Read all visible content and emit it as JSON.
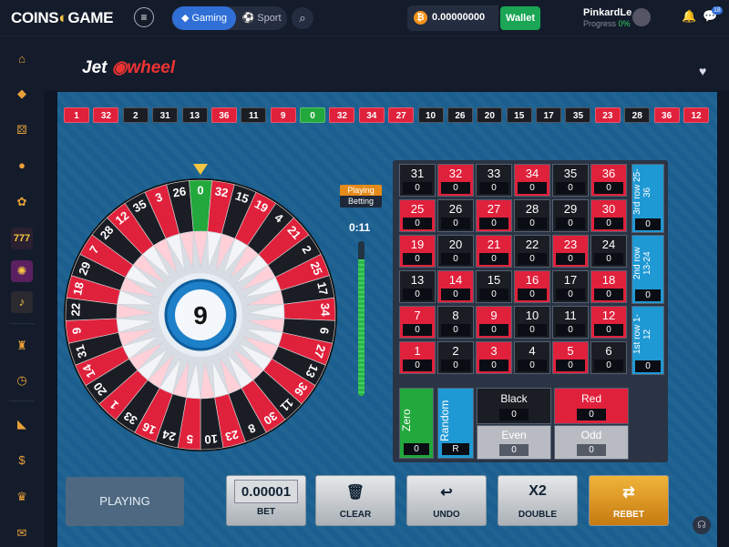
{
  "topbar": {
    "logo_part1": "COINS",
    "logo_part2": "GAME",
    "menu_icon": "≡",
    "mode_gaming": "Gaming",
    "mode_sport": "Sport",
    "balance": "0.00000000",
    "currency_icon": "₿",
    "wallet_label": "Wallet",
    "username": "PinkardLe",
    "progress_label": "Progress",
    "progress_value": "0%",
    "chat_badge": "18"
  },
  "sidebar": {
    "icons": [
      "home-icon",
      "cube-icon",
      "dice-icon",
      "ball-icon",
      "candy-icon",
      "slots-777-icon",
      "wheel-icon",
      "bell-icon",
      "castle-icon",
      "clock-icon",
      "cheese-icon",
      "money-bag-icon",
      "crown-icon",
      "gift-icon"
    ]
  },
  "game": {
    "logo_jet": "Jet",
    "logo_wheel": "wheel",
    "result_number": "9",
    "status_top": "Playing",
    "status_bottom": "Betting",
    "timer": "0:11",
    "timer_progress": 0.88
  },
  "history": [
    {
      "n": "1",
      "c": "red"
    },
    {
      "n": "32",
      "c": "red"
    },
    {
      "n": "2",
      "c": "black"
    },
    {
      "n": "31",
      "c": "black"
    },
    {
      "n": "13",
      "c": "black"
    },
    {
      "n": "36",
      "c": "red"
    },
    {
      "n": "11",
      "c": "black"
    },
    {
      "n": "9",
      "c": "red"
    },
    {
      "n": "0",
      "c": "green"
    },
    {
      "n": "32",
      "c": "red"
    },
    {
      "n": "34",
      "c": "red"
    },
    {
      "n": "27",
      "c": "red"
    },
    {
      "n": "10",
      "c": "black"
    },
    {
      "n": "26",
      "c": "black"
    },
    {
      "n": "20",
      "c": "black"
    },
    {
      "n": "15",
      "c": "black"
    },
    {
      "n": "17",
      "c": "black"
    },
    {
      "n": "35",
      "c": "black"
    },
    {
      "n": "23",
      "c": "red"
    },
    {
      "n": "28",
      "c": "black"
    },
    {
      "n": "36",
      "c": "red"
    },
    {
      "n": "12",
      "c": "red"
    }
  ],
  "wheel": {
    "sequence": [
      "0",
      "32",
      "15",
      "19",
      "4",
      "21",
      "2",
      "25",
      "17",
      "34",
      "6",
      "27",
      "13",
      "36",
      "11",
      "30",
      "8",
      "23",
      "10",
      "5",
      "24",
      "16",
      "33",
      "1",
      "20",
      "14",
      "31",
      "9",
      "22",
      "18",
      "29",
      "7",
      "28",
      "12",
      "35",
      "3",
      "26"
    ],
    "red_numbers": [
      "1",
      "3",
      "5",
      "7",
      "9",
      "12",
      "14",
      "16",
      "18",
      "19",
      "21",
      "23",
      "25",
      "27",
      "30",
      "32",
      "34",
      "36"
    ]
  },
  "board": {
    "grid": [
      [
        "31",
        "32",
        "33",
        "34",
        "35",
        "36"
      ],
      [
        "25",
        "26",
        "27",
        "28",
        "29",
        "30"
      ],
      [
        "19",
        "20",
        "21",
        "22",
        "23",
        "24"
      ],
      [
        "13",
        "14",
        "15",
        "16",
        "17",
        "18"
      ],
      [
        "7",
        "8",
        "9",
        "10",
        "11",
        "12"
      ],
      [
        "1",
        "2",
        "3",
        "4",
        "5",
        "6"
      ]
    ],
    "bet_value": "0",
    "rows": [
      {
        "label": "3rd row 25-36",
        "bet": "0"
      },
      {
        "label": "2nd row 13-24",
        "bet": "0"
      },
      {
        "label": "1st row 1-12",
        "bet": "0"
      }
    ],
    "zero_label": "Zero",
    "zero_bet": "0",
    "random_label": "Random",
    "random_bet": "R",
    "black_label": "Black",
    "black_bet": "0",
    "red_label": "Red",
    "red_bet": "0",
    "even_label": "Even",
    "even_bet": "0",
    "odd_label": "Odd",
    "odd_bet": "0"
  },
  "controls": {
    "playing": "PLAYING",
    "bet_value": "0.00001",
    "bet_label": "BET",
    "clear_icon": "🗑",
    "clear_label": "CLEAR",
    "undo_icon": "↩",
    "undo_label": "UNDO",
    "double_icon": "X2",
    "double_label": "DOUBLE",
    "rebet_icon": "⇄",
    "rebet_label": "REBET"
  },
  "colors": {
    "red": "#e0213c",
    "black": "#1a1d24",
    "green": "#22a83c",
    "accent": "#2f6fd6",
    "stage": "#1a5f8f"
  }
}
